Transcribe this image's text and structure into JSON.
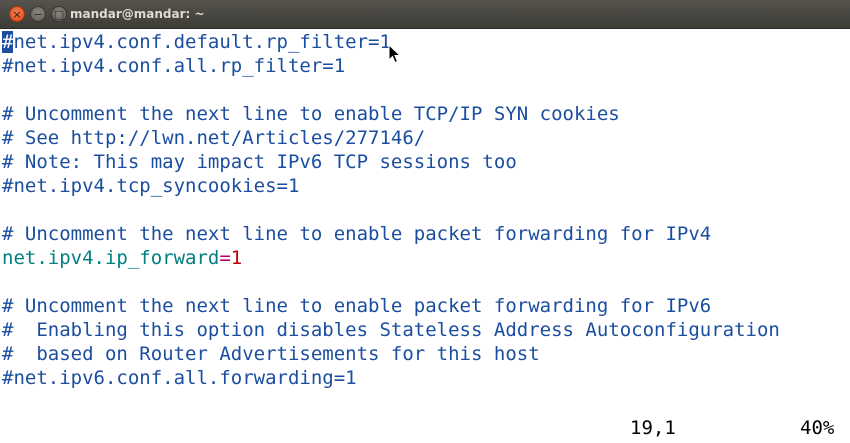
{
  "window": {
    "title": "mandar@mandar: ~",
    "close_glyph": "×",
    "min_glyph": "−",
    "max_glyph": "□"
  },
  "editor": {
    "cursor_char": "#",
    "lines": [
      {
        "rest": "net.ipv4.conf.default.rp_filter=1"
      },
      {
        "text": "#net.ipv4.conf.all.rp_filter=1"
      },
      {
        "text": ""
      },
      {
        "text": "# Uncomment the next line to enable TCP/IP SYN cookies"
      },
      {
        "text": "# See http://lwn.net/Articles/277146/"
      },
      {
        "text": "# Note: This may impact IPv6 TCP sessions too"
      },
      {
        "text": "#net.ipv4.tcp_syncookies=1"
      },
      {
        "text": ""
      },
      {
        "text": "# Uncomment the next line to enable packet forwarding for IPv4"
      },
      {
        "key": "net.ipv4.ip_forward",
        "op": "=",
        "value": "1"
      },
      {
        "text": ""
      },
      {
        "text": "# Uncomment the next line to enable packet forwarding for IPv6"
      },
      {
        "text": "#  Enabling this option disables Stateless Address Autoconfiguration"
      },
      {
        "text": "#  based on Router Advertisements for this host"
      },
      {
        "text": "#net.ipv6.conf.all.forwarding=1"
      }
    ]
  },
  "statusline": {
    "position": "19,1",
    "percent": "40%"
  }
}
